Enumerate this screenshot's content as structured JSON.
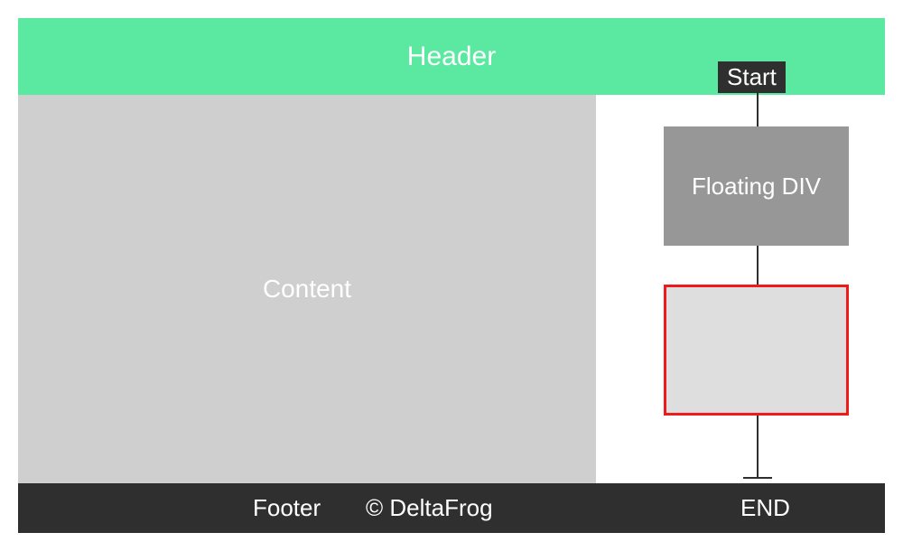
{
  "header": {
    "label": "Header"
  },
  "content": {
    "label": "Content"
  },
  "footer": {
    "label": "Footer",
    "copyright": "© DeltaFrog",
    "end": "END"
  },
  "flow": {
    "start": "Start",
    "floating": "Floating DIV"
  }
}
